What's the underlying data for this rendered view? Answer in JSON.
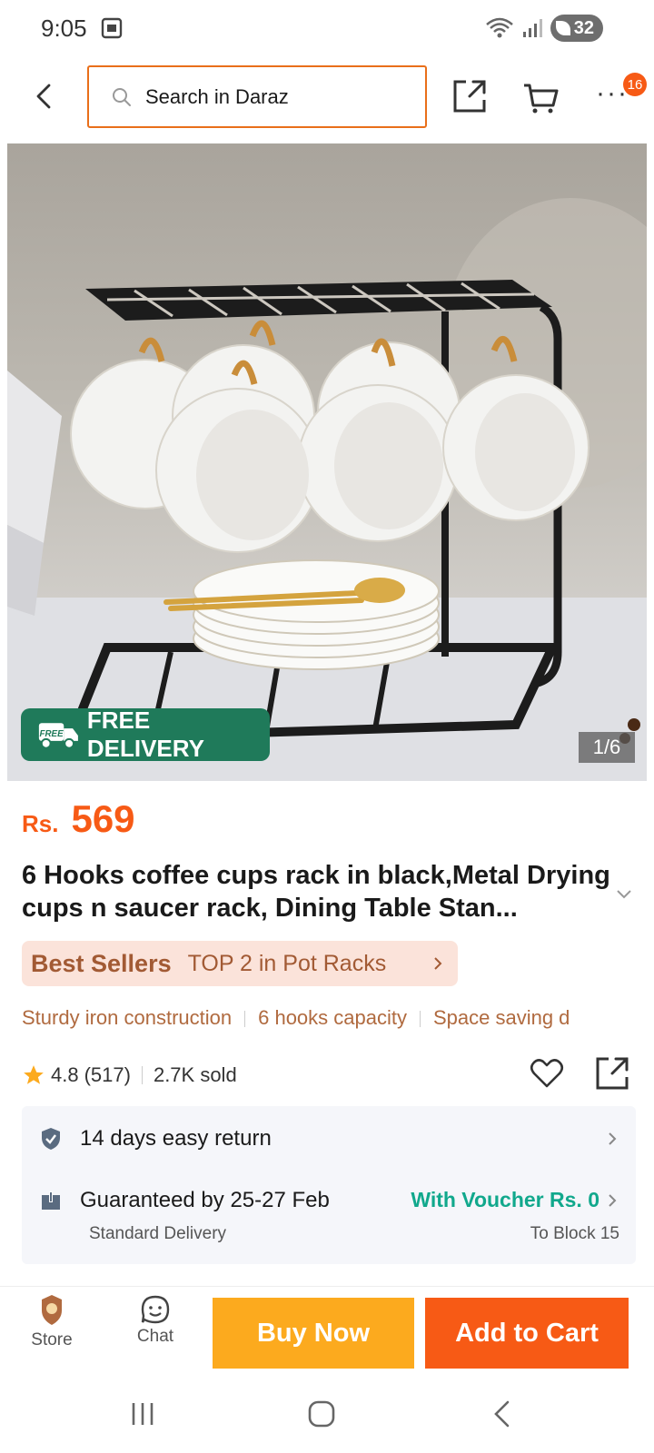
{
  "status": {
    "time": "9:05",
    "battery": "32"
  },
  "search": {
    "placeholder": "Search in Daraz"
  },
  "header": {
    "notification_count": "16"
  },
  "gallery": {
    "badge": "FREE DELIVERY",
    "badge_tag": "FREE",
    "counter": "1/6"
  },
  "product": {
    "currency": "Rs.",
    "price": "569",
    "title": "6 Hooks coffee cups rack in black,Metal Drying cups n saucer rack, Dining Table Stan..."
  },
  "bestseller": {
    "label": "Best Sellers",
    "text": "TOP 2 in Pot Racks"
  },
  "features": [
    "Sturdy iron construction",
    "6 hooks capacity",
    "Space saving d"
  ],
  "rating": {
    "score": "4.8",
    "count": "(517)",
    "sold": "2.7K sold"
  },
  "service": {
    "returns": "14 days easy return",
    "delivery": "Guaranteed by 25-27 Feb",
    "voucher": "With Voucher Rs. 0",
    "delivery_type": "Standard Delivery",
    "destination": "To Block 15"
  },
  "bottom": {
    "store": "Store",
    "chat": "Chat",
    "buy_now": "Buy Now",
    "add_to_cart": "Add to Cart"
  },
  "colors": {
    "accent": "#f75a15",
    "buy_now": "#fcaa1e",
    "free_delivery": "#1f7a5a",
    "voucher": "#11a88c"
  }
}
